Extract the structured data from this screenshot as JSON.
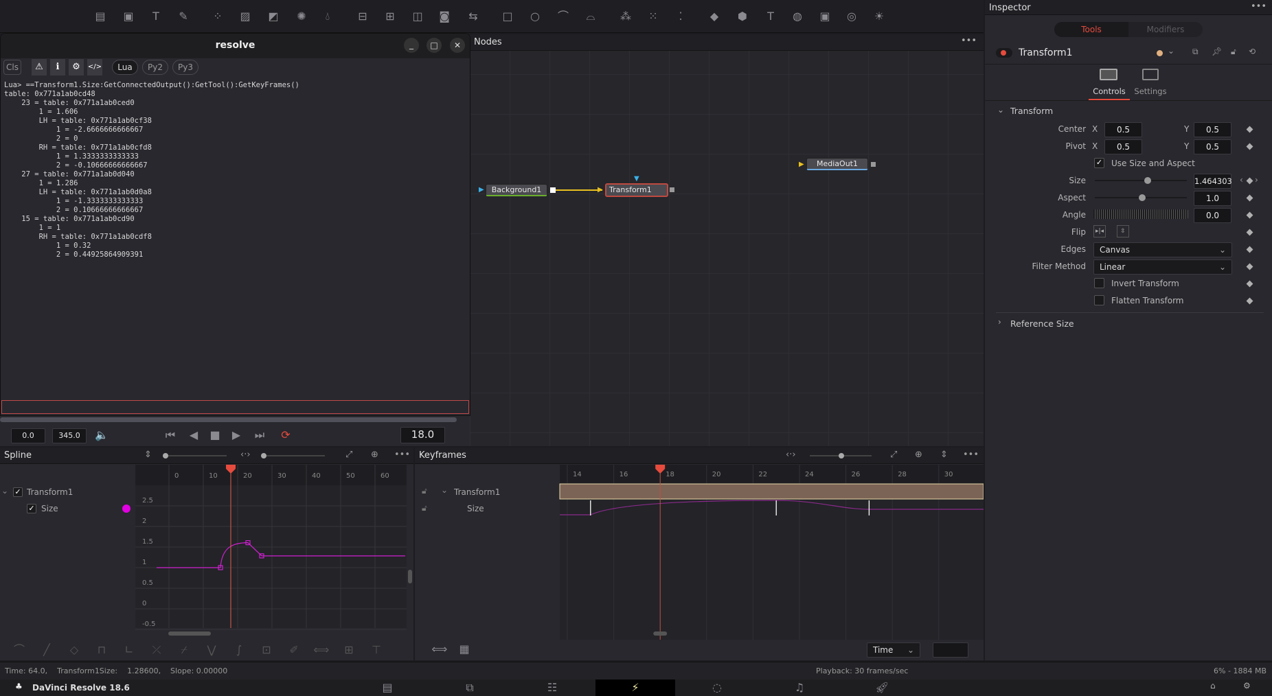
{
  "toolbar": {
    "icons": [
      "gradient-icon",
      "image-icon",
      "text-icon",
      "paint-icon",
      "particles-icon",
      "mask-icon",
      "polygon-icon",
      "glow-icon",
      "color-icon",
      "merge-icon",
      "transform-icon",
      "layers-icon",
      "matte-icon",
      "loop-icon",
      "rectangle-icon",
      "ellipse-icon",
      "polygon-mask-icon",
      "bspline-icon",
      "particle-emitter-icon",
      "particle-render-icon",
      "particle-grid-icon",
      "shape3d-icon",
      "merge3d-icon",
      "text3d-icon",
      "camera3d-icon",
      "imageplane-icon",
      "renderer3d-icon",
      "light-icon"
    ]
  },
  "console": {
    "title": "resolve",
    "buttons": {
      "cls": "Cls",
      "lua": "Lua",
      "py2": "Py2",
      "py3": "Py3"
    },
    "lines": [
      "Lua> ==Transform1.Size:GetConnectedOutput():GetTool():GetKeyFrames()",
      "table: 0x771a1ab0cd48",
      "    23 = table: 0x771a1ab0ced0",
      "        1 = 1.606",
      "        LH = table: 0x771a1ab0cf38",
      "            1 = -2.6666666666667",
      "            2 = 0",
      "        RH = table: 0x771a1ab0cfd8",
      "            1 = 1.3333333333333",
      "            2 = -0.10666666666667",
      "    27 = table: 0x771a1ab0d040",
      "        1 = 1.286",
      "        LH = table: 0x771a1ab0d0a8",
      "            1 = -1.3333333333333",
      "            2 = 0.10666666666667",
      "    15 = table: 0x771a1ab0cd90",
      "        1 = 1",
      "        RH = table: 0x771a1ab0cdf8",
      "            1 = 0.32",
      "            2 = 0.44925864909391"
    ],
    "input_value": ""
  },
  "nodes": {
    "title": "Nodes",
    "items": [
      "Background1",
      "Transform1",
      "MediaOut1"
    ]
  },
  "transport": {
    "start": "0.0",
    "end": "345.0",
    "current": "18.0"
  },
  "spline": {
    "title": "Spline",
    "tree": {
      "tool": "Transform1",
      "param": "Size"
    },
    "x_ticks": [
      0,
      10,
      20,
      30,
      40,
      50,
      60
    ],
    "y_ticks": [
      "2.5",
      "2",
      "1.5",
      "1",
      "0.5",
      "0",
      "-0.5"
    ],
    "keyframes": [
      {
        "frame": 15,
        "value": 1
      },
      {
        "frame": 23,
        "value": 1.606
      },
      {
        "frame": 27,
        "value": 1.286
      }
    ],
    "curve_color": "#d020d0"
  },
  "keyframes_panel": {
    "title": "Keyframes",
    "tree": {
      "tool": "Transform1",
      "param": "Size"
    },
    "ticks": [
      14,
      16,
      18,
      20,
      22,
      24,
      26,
      28,
      30
    ],
    "keyframes": [
      15,
      23,
      27
    ],
    "time_mode": "Time"
  },
  "playhead_frame": 18,
  "inspector": {
    "title": "Inspector",
    "tabs": [
      "Tools",
      "Modifiers"
    ],
    "tool_name": "Transform1",
    "subtabs": [
      "Controls",
      "Settings"
    ],
    "section": "Transform",
    "center": {
      "label": "Center",
      "x": "0.5",
      "y": "0.5"
    },
    "pivot": {
      "label": "Pivot",
      "x": "0.5",
      "y": "0.5"
    },
    "use_size": {
      "label": "Use Size and Aspect",
      "checked": true
    },
    "size": {
      "label": "Size",
      "value": "1.464303"
    },
    "aspect": {
      "label": "Aspect",
      "value": "1.0"
    },
    "angle": {
      "label": "Angle",
      "value": "0.0"
    },
    "flip": {
      "label": "Flip"
    },
    "edges": {
      "label": "Edges",
      "value": "Canvas"
    },
    "filter": {
      "label": "Filter Method",
      "value": "Linear"
    },
    "invert": {
      "label": "Invert Transform",
      "checked": false
    },
    "flatten": {
      "label": "Flatten Transform",
      "checked": false
    },
    "reference": "Reference Size",
    "accent": "#e64b3d"
  },
  "status": {
    "left": "Time: 64.0,    Transform1Size:    1.28600,    Slope: 0.00000",
    "center": "Playback: 30 frames/sec",
    "right": "6% - 1884 MB"
  },
  "app": {
    "name": "DaVinci Resolve 18.6",
    "pages": [
      "media-page",
      "cut-page",
      "edit-page",
      "fusion-page",
      "color-page",
      "fairlight-page",
      "deliver-page"
    ],
    "active_page": "fusion-page"
  }
}
